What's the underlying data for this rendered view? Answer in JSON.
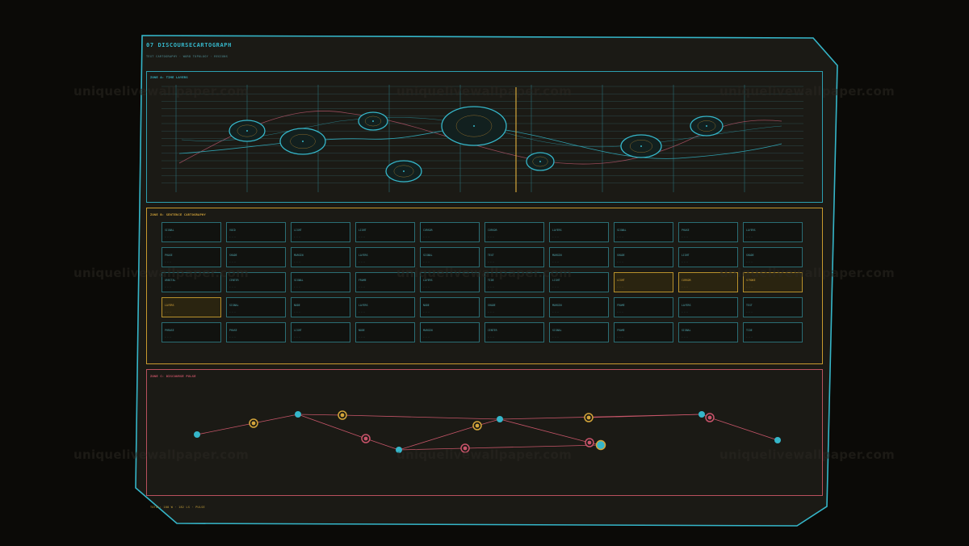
{
  "header": {
    "title": "07 DISCOURSECARTOGRAPH",
    "subtitle": "TEXT CARTOGRAPHY · WORD TOPOLOGY · REGIONS"
  },
  "zones": {
    "a_label": "ZONE A: TIME LAYERS",
    "b_label": "ZONE B: SENTENCE CARTOGRAPHY",
    "c_label": "ZONE C: DISCOURSE PULSE"
  },
  "grid_cells": [
    [
      {
        "w": "SIGNAL",
        "m": "— — —"
      },
      {
        "w": "VOID",
        "m": "— — —"
      },
      {
        "w": "LIGHT",
        "m": "— — —"
      },
      {
        "w": "LIGHT",
        "m": "— — —"
      },
      {
        "w": "CURSOR",
        "m": "— — —"
      },
      {
        "w": "CURSOR",
        "m": "— — —"
      },
      {
        "w": "LAYERS",
        "m": "— — —"
      },
      {
        "w": "SIGNAL",
        "m": "— — —"
      },
      {
        "w": "PHASE",
        "m": "— — —"
      },
      {
        "w": "LAYERS",
        "m": "— — —"
      }
    ],
    [
      {
        "w": "PHASE",
        "m": "— — —"
      },
      {
        "w": "SHADE",
        "m": "— — —"
      },
      {
        "w": "MARGIN",
        "m": "— — —"
      },
      {
        "w": "LAYERS",
        "m": "— — —"
      },
      {
        "w": "SIGNAL",
        "m": "— — —"
      },
      {
        "w": "TEXT",
        "m": "— — —"
      },
      {
        "w": "MARGIN",
        "m": "— — —"
      },
      {
        "w": "SHADE",
        "m": "— — —"
      },
      {
        "w": "LIGHT",
        "m": "— — —"
      },
      {
        "w": "SHADE",
        "m": "— — —"
      }
    ],
    [
      {
        "w": "ORBITAL",
        "m": "— — —"
      },
      {
        "w": "CENTER",
        "m": "— — —"
      },
      {
        "w": "SIGNAL",
        "m": "— — —"
      },
      {
        "w": "FRAME",
        "m": "— — —"
      },
      {
        "w": "LAYERS",
        "m": "— — —"
      },
      {
        "w": "TIDE",
        "m": "— — —"
      },
      {
        "w": "LIGHT",
        "m": "— — —"
      },
      {
        "w": "LIGHT",
        "m": "— — —",
        "hl": true
      },
      {
        "w": "CURSOR",
        "m": "— — —",
        "hl": true
      },
      {
        "w": "STROKE",
        "m": "— — —",
        "hl": true
      }
    ],
    [
      {
        "w": "LAYERS",
        "m": "— — —",
        "hl": true
      },
      {
        "w": "SIGNAL",
        "m": "— — —"
      },
      {
        "w": "NODE",
        "m": "— — —"
      },
      {
        "w": "LAYERS",
        "m": "— — —"
      },
      {
        "w": "NODE",
        "m": "— — —"
      },
      {
        "w": "SHADE",
        "m": "— — —"
      },
      {
        "w": "MARGIN",
        "m": "— — —"
      },
      {
        "w": "FRAME",
        "m": "— — —"
      },
      {
        "w": "LAYERS",
        "m": "— — —"
      },
      {
        "w": "TEXT",
        "m": "— — —"
      }
    ],
    [
      {
        "w": "PHRASE",
        "m": "— — —"
      },
      {
        "w": "PHASE",
        "m": "— — —"
      },
      {
        "w": "LIGHT",
        "m": "— — —"
      },
      {
        "w": "NODE",
        "m": "— — —"
      },
      {
        "w": "MARGIN",
        "m": "— — —"
      },
      {
        "w": "CENTER",
        "m": "— — —"
      },
      {
        "w": "SIGNAL",
        "m": "— — —"
      },
      {
        "w": "FRAME",
        "m": "— — —"
      },
      {
        "w": "SIGNAL",
        "m": "— — —"
      },
      {
        "w": "TIDE",
        "m": "— — —"
      }
    ]
  ],
  "footer": "TOTAL: 108 W · 182 LS · PULSE",
  "watermark": "uniquelivewallpaper.com",
  "colors": {
    "cyan": "#35b6c9",
    "amber": "#d4a53a",
    "rose": "#c8536a",
    "panel": "#1a1914"
  }
}
